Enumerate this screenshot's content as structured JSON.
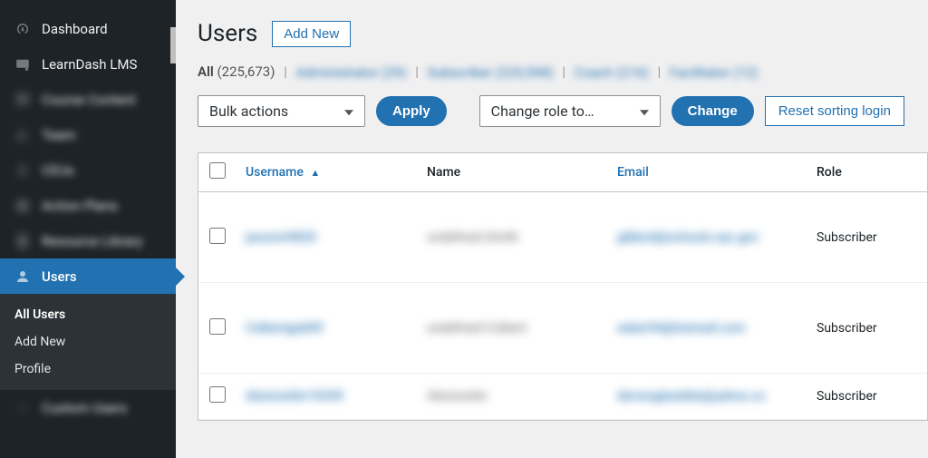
{
  "sidebar": {
    "items": [
      {
        "label": "Dashboard",
        "icon": "gauge"
      },
      {
        "label": "LearnDash LMS",
        "icon": "learndash"
      },
      {
        "label": "Course Content",
        "icon": "book",
        "blur": true
      },
      {
        "label": "Team",
        "icon": "people",
        "blur": true
      },
      {
        "label": "CEUs",
        "icon": "award",
        "blur": true
      },
      {
        "label": "Action Plans",
        "icon": "map",
        "blur": true
      },
      {
        "label": "Resource Library",
        "icon": "doc",
        "blur": true
      },
      {
        "label": "Users",
        "icon": "user",
        "active": true
      }
    ],
    "submenu": [
      {
        "label": "All Users",
        "active": true
      },
      {
        "label": "Add New"
      },
      {
        "label": "Profile"
      }
    ],
    "trailing_blur_label": "Custom Users"
  },
  "page": {
    "title": "Users",
    "add_new_label": "Add New"
  },
  "filters": {
    "all_label": "All",
    "all_count": "(225,673)",
    "blurred_links": [
      "Administrator (29)",
      "Subscriber (225,598)",
      "Coach (216)",
      "Facilitator (12)"
    ]
  },
  "toolbar": {
    "bulk_placeholder": "Bulk actions",
    "apply_label": "Apply",
    "change_role_placeholder": "Change role to…",
    "change_label": "Change",
    "reset_label": "Reset sorting login"
  },
  "table": {
    "columns": {
      "username": "Username",
      "name": "Name",
      "email": "Email",
      "role": "Role"
    },
    "rows": [
      {
        "username": "jasonm9820",
        "name": "undefined Smith",
        "email": "gibbs4@schools.nyc.gov",
        "role": "Subscriber"
      },
      {
        "username": "Colbertga609",
        "name": "undefined Colbert",
        "email": "asker94@hotmail.com",
        "role": "Subscriber"
      },
      {
        "username": "Alexiswiler10349",
        "name": "Alexiswiler",
        "email": "derrenglandele@yahoo.co",
        "role": "Subscriber"
      }
    ]
  }
}
